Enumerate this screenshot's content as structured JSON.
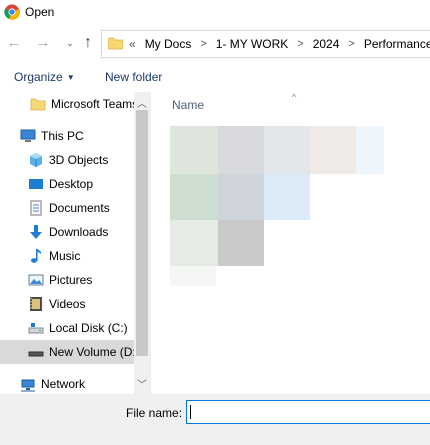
{
  "window": {
    "title": "Open",
    "app_icon": "chrome-icon"
  },
  "nav": {
    "back_icon": "arrow-left-icon",
    "forward_icon": "arrow-right-icon",
    "recent_icon": "chevron-down-icon",
    "up_icon": "arrow-up-icon",
    "breadcrumb_lead": "«",
    "breadcrumbs": [
      "My Docs",
      "1- MY WORK",
      "2024",
      "Performance"
    ],
    "separator": ">"
  },
  "commands": {
    "organize_label": "Organize",
    "new_folder_label": "New folder"
  },
  "sidebar": {
    "items": [
      {
        "label": "Microsoft Teams",
        "icon": "folder-icon"
      },
      {
        "label": "This PC",
        "icon": "computer-icon"
      },
      {
        "label": "3D Objects",
        "icon": "cube-icon"
      },
      {
        "label": "Desktop",
        "icon": "desktop-icon"
      },
      {
        "label": "Documents",
        "icon": "documents-icon"
      },
      {
        "label": "Downloads",
        "icon": "download-icon"
      },
      {
        "label": "Music",
        "icon": "music-icon"
      },
      {
        "label": "Pictures",
        "icon": "pictures-icon"
      },
      {
        "label": "Videos",
        "icon": "videos-icon"
      },
      {
        "label": "Local Disk (C:)",
        "icon": "drive-icon"
      },
      {
        "label": "New Volume (D:)",
        "icon": "drive-icon",
        "selected": true
      },
      {
        "label": "Network",
        "icon": "network-icon"
      }
    ]
  },
  "content": {
    "column_header": "Name"
  },
  "filename": {
    "label": "File name:",
    "value": ""
  },
  "colors": {
    "accent": "#0078d7",
    "command_text": "#1e3a6a",
    "folder_yellow": "#f8d775",
    "selected_bg": "#d9d9d9"
  }
}
